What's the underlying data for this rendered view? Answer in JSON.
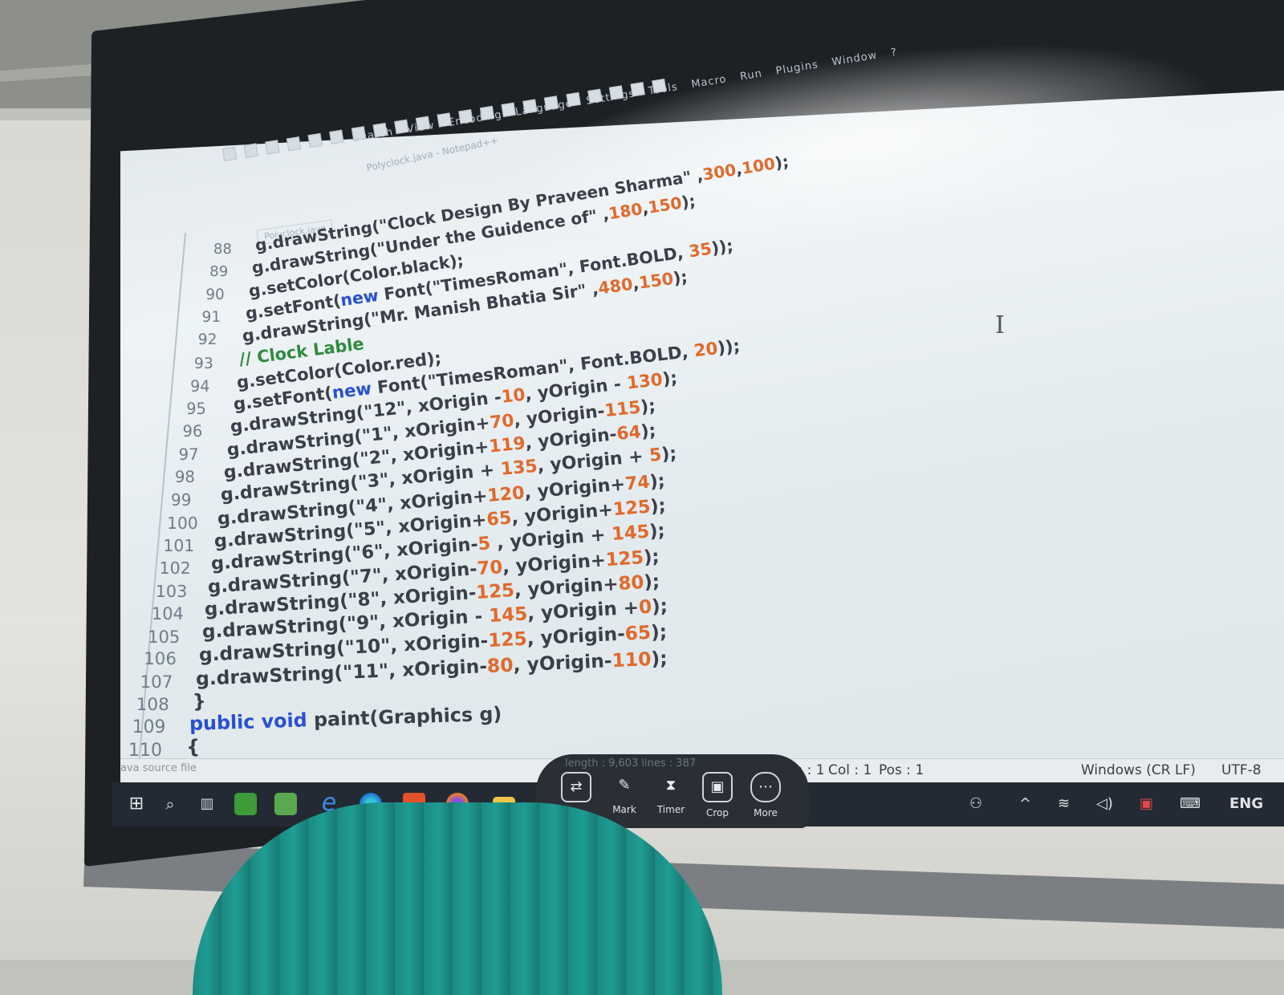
{
  "editor": {
    "title": "Polyclock.java - Notepad++",
    "menu": [
      "Search",
      "View",
      "Encoding",
      "Language",
      "Settings",
      "Tools",
      "Macro",
      "Run",
      "Plugins",
      "Window",
      "?"
    ],
    "tab_label": "Polyclock.java",
    "code_lines": [
      {
        "num": "88",
        "parts": [
          [
            "g.drawString(\"Clock Design By Praveen Sharma\" ,",
            "str"
          ],
          [
            "300",
            "num"
          ],
          [
            ",",
            "str"
          ],
          [
            "100",
            "num"
          ],
          [
            ");",
            "str"
          ]
        ]
      },
      {
        "num": "89",
        "parts": [
          [
            "g.drawString(\"Under the Guidence of\" ,",
            "str"
          ],
          [
            "180",
            "num"
          ],
          [
            ",",
            "str"
          ],
          [
            "150",
            "num"
          ],
          [
            ");",
            "str"
          ]
        ]
      },
      {
        "num": "90",
        "parts": [
          [
            "g.setColor(Color.black);",
            "str"
          ]
        ]
      },
      {
        "num": "91",
        "parts": [
          [
            "g.setFont(",
            "str"
          ],
          [
            "new",
            "kw"
          ],
          [
            " Font(\"TimesRoman\", Font.BOLD, ",
            "str"
          ],
          [
            "35",
            "num"
          ],
          [
            "));",
            "str"
          ]
        ]
      },
      {
        "num": "92",
        "parts": [
          [
            "g.drawString(\"Mr. Manish Bhatia Sir\" ,",
            "str"
          ],
          [
            "480",
            "num"
          ],
          [
            ",",
            "str"
          ],
          [
            "150",
            "num"
          ],
          [
            ");",
            "str"
          ]
        ]
      },
      {
        "num": "93",
        "parts": [
          [
            "// Clock Lable",
            "com"
          ]
        ]
      },
      {
        "num": "94",
        "parts": [
          [
            "g.setColor(Color.red);",
            "str"
          ]
        ]
      },
      {
        "num": "95",
        "parts": [
          [
            "g.setFont(",
            "str"
          ],
          [
            "new",
            "kw"
          ],
          [
            " Font(\"TimesRoman\", Font.BOLD, ",
            "str"
          ],
          [
            "20",
            "num"
          ],
          [
            "));",
            "str"
          ]
        ]
      },
      {
        "num": "96",
        "parts": [
          [
            "g.drawString(\"12\", xOrigin -",
            "str"
          ],
          [
            "10",
            "num"
          ],
          [
            ", yOrigin - ",
            "str"
          ],
          [
            "130",
            "num"
          ],
          [
            ");",
            "str"
          ]
        ]
      },
      {
        "num": "97",
        "parts": [
          [
            "g.drawString(\"1\", xOrigin+",
            "str"
          ],
          [
            "70",
            "num"
          ],
          [
            ", yOrigin-",
            "str"
          ],
          [
            "115",
            "num"
          ],
          [
            ");",
            "str"
          ]
        ]
      },
      {
        "num": "98",
        "parts": [
          [
            "g.drawString(\"2\", xOrigin+",
            "str"
          ],
          [
            "119",
            "num"
          ],
          [
            ", yOrigin-",
            "str"
          ],
          [
            "64",
            "num"
          ],
          [
            ");",
            "str"
          ]
        ]
      },
      {
        "num": "99",
        "parts": [
          [
            "g.drawString(\"3\", xOrigin + ",
            "str"
          ],
          [
            "135",
            "num"
          ],
          [
            ", yOrigin + ",
            "str"
          ],
          [
            "5",
            "num"
          ],
          [
            ");",
            "str"
          ]
        ]
      },
      {
        "num": "100",
        "parts": [
          [
            "g.drawString(\"4\", xOrigin+",
            "str"
          ],
          [
            "120",
            "num"
          ],
          [
            ", yOrigin+",
            "str"
          ],
          [
            "74",
            "num"
          ],
          [
            ");",
            "str"
          ]
        ]
      },
      {
        "num": "101",
        "parts": [
          [
            "g.drawString(\"5\", xOrigin+",
            "str"
          ],
          [
            "65",
            "num"
          ],
          [
            ", yOrigin+",
            "str"
          ],
          [
            "125",
            "num"
          ],
          [
            ");",
            "str"
          ]
        ]
      },
      {
        "num": "102",
        "parts": [
          [
            "g.drawString(\"6\", xOrigin-",
            "str"
          ],
          [
            "5",
            "num"
          ],
          [
            " , yOrigin + ",
            "str"
          ],
          [
            "145",
            "num"
          ],
          [
            ");",
            "str"
          ]
        ]
      },
      {
        "num": "103",
        "parts": [
          [
            "g.drawString(\"7\", xOrigin-",
            "str"
          ],
          [
            "70",
            "num"
          ],
          [
            ", yOrigin+",
            "str"
          ],
          [
            "125",
            "num"
          ],
          [
            ");",
            "str"
          ]
        ]
      },
      {
        "num": "104",
        "parts": [
          [
            "g.drawString(\"8\", xOrigin-",
            "str"
          ],
          [
            "125",
            "num"
          ],
          [
            ", yOrigin+",
            "str"
          ],
          [
            "80",
            "num"
          ],
          [
            ");",
            "str"
          ]
        ]
      },
      {
        "num": "105",
        "parts": [
          [
            "g.drawString(\"9\", xOrigin - ",
            "str"
          ],
          [
            "145",
            "num"
          ],
          [
            ", yOrigin +",
            "str"
          ],
          [
            "0",
            "num"
          ],
          [
            ");",
            "str"
          ]
        ]
      },
      {
        "num": "106",
        "parts": [
          [
            "g.drawString(\"10\", xOrigin-",
            "str"
          ],
          [
            "125",
            "num"
          ],
          [
            ", yOrigin-",
            "str"
          ],
          [
            "65",
            "num"
          ],
          [
            ");",
            "str"
          ]
        ]
      },
      {
        "num": "107",
        "parts": [
          [
            "g.drawString(\"11\", xOrigin-",
            "str"
          ],
          [
            "80",
            "num"
          ],
          [
            ", yOrigin-",
            "str"
          ],
          [
            "110",
            "num"
          ],
          [
            ");",
            "str"
          ]
        ]
      },
      {
        "num": "108",
        "parts": [
          [
            "}",
            "str"
          ]
        ]
      },
      {
        "num": "109",
        "parts": [
          [
            "public void",
            "kw"
          ],
          [
            " paint(Graphics g)",
            "str"
          ]
        ]
      },
      {
        "num": "110",
        "parts": [
          [
            "{",
            "str"
          ]
        ]
      }
    ],
    "colors": {
      "keyword": "#2a4fd1",
      "number": "#e06a2c",
      "comment": "#2f8a3e",
      "text": "#2b2f38"
    }
  },
  "statusbar": {
    "file_type": "ava source file",
    "length": "length : 9,603",
    "lines": "lines : 387",
    "ln": "Ln : 1",
    "col": "Col : 1",
    "pos": "Pos : 1",
    "eol": "Windows (CR LF)",
    "encoding": "UTF-8"
  },
  "whiteboard_toolbar": {
    "buttons": [
      {
        "icon": "switch-icon",
        "label": ""
      },
      {
        "icon": "pen-icon",
        "label": "Mark"
      },
      {
        "icon": "hourglass-icon",
        "label": "Timer"
      },
      {
        "icon": "crop-icon",
        "label": "Crop"
      },
      {
        "icon": "more-icon",
        "label": "More"
      }
    ]
  },
  "taskbar": {
    "icons": [
      "windows-icon",
      "search-icon",
      "task-view-icon",
      "app-green-icon",
      "app-green2-icon",
      "ie-icon",
      "edge-icon",
      "brave-icon",
      "firefox-icon",
      "folder-icon"
    ],
    "tray_language": "ENG"
  }
}
